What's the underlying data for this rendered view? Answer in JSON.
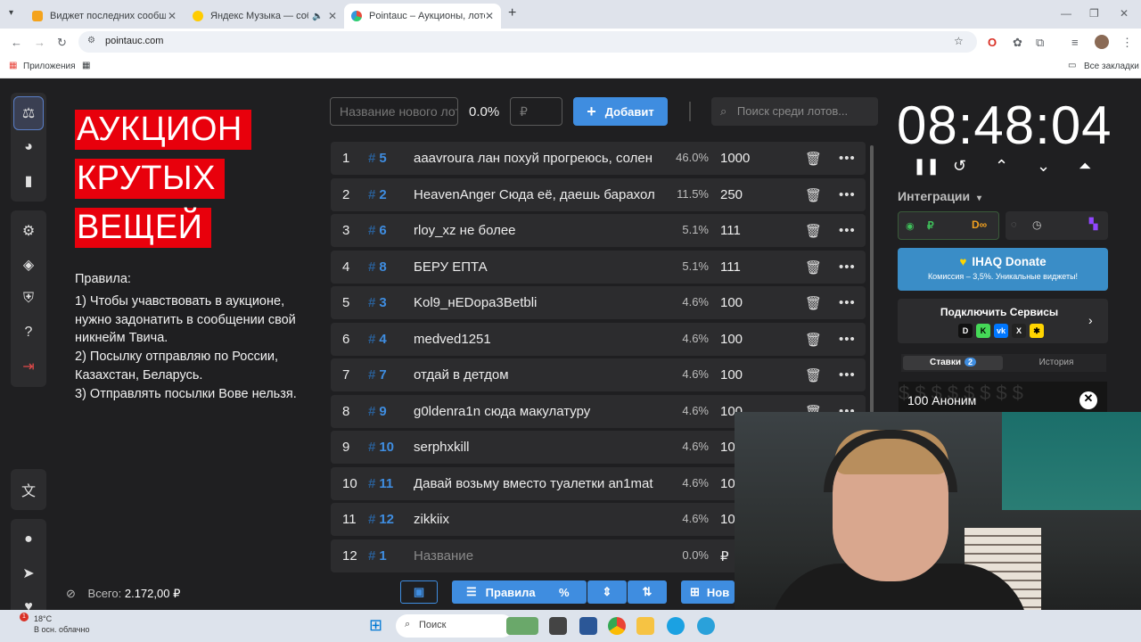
{
  "browser": {
    "tabs": [
      {
        "title": "Виджет последних сообщени",
        "active": false
      },
      {
        "title": "Яндекс Музыка — собирае",
        "active": false
      },
      {
        "title": "Pointauc – Аукционы, лотереи",
        "active": true
      }
    ],
    "url": "pointauc.com",
    "bookmarks_apps": "Приложения",
    "bookmarks_all": "Все закладки"
  },
  "sidebar": {
    "icons": [
      "auction-icon",
      "pie-chart-icon",
      "bar-chart-icon",
      "settings-icon",
      "layers-icon",
      "shield-icon",
      "help-icon",
      "logout-icon",
      "translate-icon",
      "github-icon",
      "telegram-icon",
      "donate-hand-icon"
    ]
  },
  "hero": {
    "line1": "АУКЦИОН",
    "line2": "КРУТЫХ",
    "line3": "ВЕЩЕЙ"
  },
  "rules": {
    "heading": "Правила:",
    "r1": "1) Чтобы учавствовать в аукционе, нужно задонатить в сообщении свой никнейм Твича.",
    "r2": "2) Посылку отправляю по России, Казахстан, Беларусь.",
    "r3": "3) Отправлять посылки Вове нельзя."
  },
  "total": {
    "label": "Всего:",
    "value": "2.172,00 ₽"
  },
  "add_form": {
    "name_placeholder": "Название нового лота",
    "percent": "0.0%",
    "amount_placeholder": "₽",
    "add_label": "Добавит",
    "search_placeholder": "Поиск среди лотов..."
  },
  "lots": [
    {
      "idx": "1",
      "id": "5",
      "name": "aaavroura лан похуй прогреюсь, солен",
      "pct": "46.0%",
      "amount": "1000"
    },
    {
      "idx": "2",
      "id": "2",
      "name": "HeavenAnger Сюда её, даешь барахол",
      "pct": "11.5%",
      "amount": "250"
    },
    {
      "idx": "3",
      "id": "6",
      "name": "rloy_xz не более",
      "pct": "5.1%",
      "amount": "111"
    },
    {
      "idx": "4",
      "id": "8",
      "name": "БЕРУ ЕПТА",
      "pct": "5.1%",
      "amount": "111"
    },
    {
      "idx": "5",
      "id": "3",
      "name": "Kol9_нEDopa3Betbli",
      "pct": "4.6%",
      "amount": "100"
    },
    {
      "idx": "6",
      "id": "4",
      "name": "medved1251",
      "pct": "4.6%",
      "amount": "100"
    },
    {
      "idx": "7",
      "id": "7",
      "name": "отдай в детдом",
      "pct": "4.6%",
      "amount": "100"
    },
    {
      "idx": "8",
      "id": "9",
      "name": "g0ldenra1n сюда макулатуру",
      "pct": "4.6%",
      "amount": "100"
    },
    {
      "idx": "9",
      "id": "10",
      "name": "serphxkill",
      "pct": "4.6%",
      "amount": "10"
    },
    {
      "idx": "10",
      "id": "11",
      "name": "Давай возьму вместо туалетки an1mat",
      "pct": "4.6%",
      "amount": "10"
    },
    {
      "idx": "11",
      "id": "12",
      "name": "zikkiix",
      "pct": "4.6%",
      "amount": "10"
    },
    {
      "idx": "12",
      "id": "1",
      "name": "Название",
      "pct": "0.0%",
      "amount": "₽",
      "placeholder": true
    }
  ],
  "bottom_bar": {
    "rules_label": "Правила",
    "new_label": "Нов"
  },
  "timer": {
    "value": "08:48:04"
  },
  "integrations": {
    "label": "Интеграции"
  },
  "donate": {
    "title": "IHAQ Donate",
    "subtitle": "Комиссия – 3,5%. Уникальные виджеты!"
  },
  "services": {
    "title": "Подключить Сервисы"
  },
  "bids_tabs": {
    "bets_label": "Ставки",
    "bets_count": "2",
    "history_label": "История"
  },
  "bid_card": {
    "text": "100 Аноним"
  },
  "taskbar": {
    "temp": "18°C",
    "weather": "В осн. облачно",
    "search": "Поиск",
    "badge": "1"
  },
  "colors": {
    "accent": "#3f8de0",
    "hero_red": "#e8000c",
    "bg": "#1f1f21",
    "row": "#2c2c2e"
  }
}
